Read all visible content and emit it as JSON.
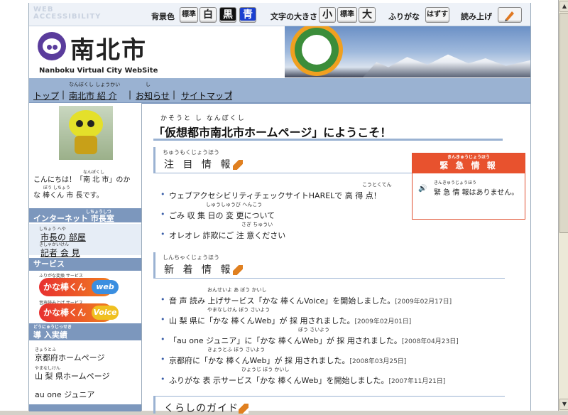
{
  "toolbar": {
    "watermark": "WEB ACCESSIBILITY",
    "bg_label": "背景色",
    "bg_standard": "標準",
    "bg_white": "白",
    "bg_black": "黒",
    "bg_blue": "青",
    "size_label": "文字の大きさ",
    "size_small": "小",
    "size_standard": "標準",
    "size_large": "大",
    "furigana_label": "ふりがな",
    "furigana_off": "はずす",
    "read_label": "読み上げ",
    "read_icon": "speaker-pen-icon"
  },
  "header": {
    "site_name": "南北市",
    "site_name_en": "Nanboku Virtual City WebSite"
  },
  "nav": {
    "items": [
      {
        "label": "トップ",
        "ruby": ""
      },
      {
        "label": "南北市 紹 介",
        "ruby": "なんぼくし しょうかい"
      },
      {
        "label": "お知らせ",
        "ruby": "し"
      },
      {
        "label": "サイトマップ",
        "ruby": ""
      }
    ]
  },
  "sidebar": {
    "intro_ruby1": "なんぼくし",
    "intro_line1": "こんにちは！「南 北 市」のか",
    "intro_ruby2": "ぼう しちょう",
    "intro_line2": "な 棒くん 市 長です。",
    "section_mayor": "インターネット 市長室",
    "section_mayor_ruby": "しちょうしつ",
    "mayor_links": [
      {
        "label": "市長の 部屋",
        "ruby": "しちょう へや"
      },
      {
        "label": "記者 会 見",
        "ruby": "きしゃかいけん"
      }
    ],
    "section_service": "サービス",
    "services": [
      {
        "small": "ふりがな変換 サービス",
        "main": "かな棒くん",
        "tail": "web"
      },
      {
        "small": "音声読み上げ サービス",
        "main": "かな棒くん",
        "tail": "Voice"
      }
    ],
    "section_impl": "導 入実績",
    "section_impl_ruby": "どうにゅうじっせき",
    "impl_items": [
      {
        "label": "京都府ホームページ",
        "ruby": "きょうとふ"
      },
      {
        "label": "山 梨 県ホームページ",
        "ruby": "やまなしけん"
      },
      {
        "label": "au one ジュニア",
        "ruby": ""
      }
    ]
  },
  "main": {
    "welcome_ruby": "かそうと し なんぼくし",
    "welcome": "「仮想都市南北市ホームページ」にようこそ！",
    "notice": {
      "ruby": "ちゅうもくじょうほう",
      "title": "注 目 情 報",
      "items": [
        {
          "label": "ウェブアクセシビリティチェックサイトHARELで 高 得 点！",
          "ruby": "こうとくてん"
        },
        {
          "label": "ごみ 収 集 日の 変 更について",
          "ruby": "しゅうしゅうび へんこう"
        },
        {
          "label": "オレオレ 詐欺にご 注 意ください",
          "ruby": "さぎ ちゅうい"
        }
      ]
    },
    "emergency": {
      "ruby": "きんきゅうじょうほう",
      "title": "緊 急 情 報",
      "body_ruby": "きんきゅうじょうほう",
      "body": "緊 急 情 報はありません。"
    },
    "news": {
      "ruby": "しんちゃくじょうほう",
      "title": "新 着 情 報",
      "items": [
        {
          "label": "音 声 読み 上げサービス「かな 棒くんVoice」を開始しました。",
          "date": "[2009年02月17日]",
          "ruby": "おんせいよ あ ぼう かいし"
        },
        {
          "label": "山 梨 県に「かな 棒くんWeb」が 採 用されました。",
          "date": "[2009年02月01日]",
          "ruby": "やまなしけん ぼう さいよう"
        },
        {
          "label": "「au one ジュニア」に「かな 棒くんWeb」が 採 用されました。",
          "date": "[2008年04月23日]",
          "ruby": "ぼう さいよう"
        },
        {
          "label": "京都府に「かな 棒くんWeb」が 採 用されました。",
          "date": "[2008年03月25日]",
          "ruby": "きょうとふ ぼう さいよう"
        },
        {
          "label": "ふりがな 表 示サービス「かな 棒くんWeb」を開始しました。",
          "date": "[2007年11月21日]",
          "ruby": "ひょうじ ぼう かいし"
        }
      ]
    },
    "guide": {
      "title": "くらしのガイド"
    }
  }
}
